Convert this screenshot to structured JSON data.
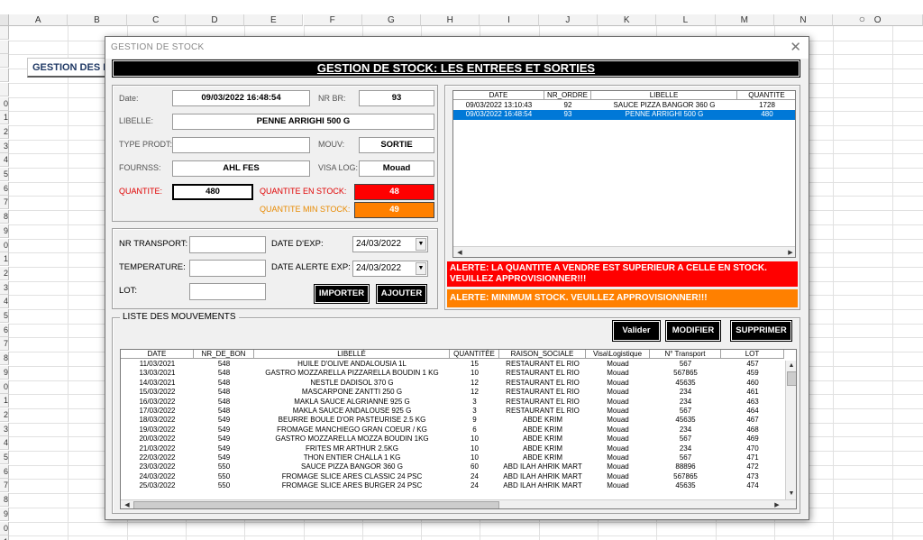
{
  "spreadsheet": {
    "columns": [
      "A",
      "B",
      "C",
      "D",
      "E",
      "F",
      "G",
      "H",
      "I",
      "J",
      "K",
      "L",
      "M",
      "N",
      "O"
    ],
    "rows": [
      "",
      "",
      "",
      "",
      "",
      "0",
      "1",
      "2",
      "3",
      "4",
      "5",
      "6",
      "7",
      "8",
      "9",
      "0",
      "1",
      "2",
      "3",
      "4",
      "5",
      "6",
      "7",
      "8",
      "9",
      "0",
      "1",
      "2",
      "3",
      "4",
      "5",
      "6",
      "7",
      "8",
      "9",
      "0",
      "1",
      "2"
    ],
    "cell_title": "GESTION DES MO",
    "close_glyph": "○"
  },
  "dialog": {
    "title": "GESTION DE STOCK",
    "close_glyph": "✕",
    "banner": "GESTION DE STOCK: LES ENTREES ET SORTIES"
  },
  "form": {
    "date_label": "Date:",
    "date_value": "09/03/2022 16:48:54",
    "nrbr_label": "NR BR:",
    "nrbr_value": "93",
    "libelle_label": "LIBELLE:",
    "libelle_value": "PENNE ARRIGHI 500 G",
    "type_label": "TYPE PRODT:",
    "type_value": "",
    "mouv_label": "MOUV:",
    "mouv_value": "SORTIE",
    "fourn_label": "FOURNSS:",
    "fourn_value": "AHL FES",
    "visa_label": "VISA LOG:",
    "visa_value": "Mouad",
    "qty_label": "QUANTITE:",
    "qty_value": "480",
    "stock_label": "QUANTITE EN STOCK:",
    "stock_value": "48",
    "min_label": "QUANTITE MIN STOCK:",
    "min_value": "49"
  },
  "transport": {
    "nr_label": "NR TRANSPORT:",
    "nr_value": "",
    "temp_label": "TEMPERATURE:",
    "temp_value": "",
    "lot_label": "LOT:",
    "lot_value": "",
    "exp_label": "DATE D'EXP:",
    "exp_value": "24/03/2022",
    "alert_label": "DATE ALERTE EXP:",
    "alert_value": "24/03/2022",
    "import_label": "IMPORTER",
    "add_label": "AJOUTER",
    "dropdown_glyph": "▼"
  },
  "recent": {
    "headers": [
      "DATE",
      "NR_ORDRE",
      "LIBELLE",
      "QUANTITE"
    ],
    "rows": [
      [
        "09/03/2022 13:10:43",
        "92",
        "SAUCE PIZZA BANGOR 360 G",
        "1728"
      ],
      [
        "09/03/2022 16:48:54",
        "93",
        "PENNE ARRIGHI 500 G",
        "480"
      ]
    ],
    "selected_index": 1
  },
  "alerts": {
    "stock": "ALERTE: LA QUANTITE A VENDRE EST SUPERIEUR A CELLE EN STOCK. VEUILLEZ APPROVISIONNER!!!",
    "minimum": "ALERTE: MINIMUM STOCK. VEUILLEZ APPROVISIONNER!!!"
  },
  "movements": {
    "legend": "LISTE DES MOUVEMENTS",
    "validate_label": "Valider",
    "modify_label": "MODIFIER",
    "delete_label": "SUPPRIMER",
    "headers": [
      "DATE",
      "NR_DE_BON",
      "LIBELLÉ",
      "QUANTITÉE",
      "RAISON_SOCIALE",
      "Visa\\Logistique",
      "N° Transport",
      "LOT"
    ],
    "rows": [
      [
        "11/03/2021",
        "548",
        "HUILE D'OLIVE ANDALOUSIA 1L",
        "15",
        "RESTAURANT EL RIO",
        "Mouad",
        "567",
        "457"
      ],
      [
        "13/03/2021",
        "548",
        "GASTRO MOZZARELLA PIZZARELLA BOUDIN 1 KG",
        "10",
        "RESTAURANT EL RIO",
        "Mouad",
        "567865",
        "459"
      ],
      [
        "14/03/2021",
        "548",
        "NESTLE DADISOL 370 G",
        "12",
        "RESTAURANT EL RIO",
        "Mouad",
        "45635",
        "460"
      ],
      [
        "15/03/2022",
        "548",
        "MASCARPONE ZANTTI 250 G",
        "12",
        "RESTAURANT EL RIO",
        "Mouad",
        "234",
        "461"
      ],
      [
        "16/03/2022",
        "548",
        "MAKLA SAUCE ALGRIANNE  925 G",
        "3",
        "RESTAURANT EL RIO",
        "Mouad",
        "234",
        "463"
      ],
      [
        "17/03/2022",
        "548",
        "MAKLA SAUCE ANDALOUSE  925 G",
        "3",
        "RESTAURANT EL RIO",
        "Mouad",
        "567",
        "464"
      ],
      [
        "18/03/2022",
        "549",
        "BEURRE BOULE D'OR PASTEURISE 2.5 KG",
        "9",
        "ABDE KRIM",
        "Mouad",
        "45635",
        "467"
      ],
      [
        "19/03/2022",
        "549",
        "FROMAGE MANCHIEGO GRAN COEUR / KG",
        "6",
        "ABDE KRIM",
        "Mouad",
        "234",
        "468"
      ],
      [
        "20/03/2022",
        "549",
        "GASTRO MOZZARELLA MOZZA BOUDIN 1KG",
        "10",
        "ABDE KRIM",
        "Mouad",
        "567",
        "469"
      ],
      [
        "21/03/2022",
        "549",
        "FRITES MR ARTHUR 2.5KG",
        "10",
        "ABDE KRIM",
        "Mouad",
        "234",
        "470"
      ],
      [
        "22/03/2022",
        "549",
        "THON ENTIER CHALLA 1 KG",
        "10",
        "ABDE KRIM",
        "Mouad",
        "567",
        "471"
      ],
      [
        "23/03/2022",
        "550",
        "SAUCE PIZZA BANGOR 360 G",
        "60",
        "ABD ILAH AHRIK MART",
        "Mouad",
        "88896",
        "472"
      ],
      [
        "24/03/2022",
        "550",
        "FROMAGE SLICE ARES CLASSIC 24 PSC",
        "24",
        "ABD ILAH AHRIK MART",
        "Mouad",
        "567865",
        "473"
      ],
      [
        "25/03/2022",
        "550",
        "FROMAGE SLICE ARES BURGER 24 PSC",
        "24",
        "ABD ILAH AHRIK MART",
        "Mouad",
        "45635",
        "474"
      ]
    ]
  }
}
